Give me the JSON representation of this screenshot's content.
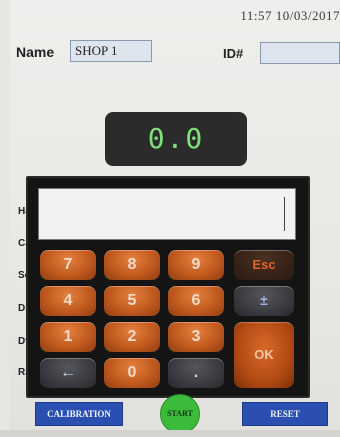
{
  "header": {
    "datetime": "11:57 10/03/2017"
  },
  "form": {
    "name_label": "Name",
    "name_value": "SHOP 1",
    "id_label": "ID#",
    "id_value": ""
  },
  "display": {
    "value": "0.0"
  },
  "side_labels": [
    "Ha",
    "Ca",
    "Se",
    "Di",
    "Dv",
    "Ra"
  ],
  "keypad": {
    "entry_value": "",
    "keys": [
      "7",
      "8",
      "9",
      "Esc",
      "4",
      "5",
      "6",
      "±",
      "1",
      "2",
      "3",
      "OK",
      "←",
      "0",
      "."
    ]
  },
  "footer": {
    "calibration_label": "CALIBRATION",
    "start_label": "START",
    "reset_label": "RESET"
  },
  "colors": {
    "display_text": "#7fe07a",
    "key_orange": "#c25a1f",
    "button_blue": "#2a4fb0",
    "start_green": "#3cba3a"
  }
}
